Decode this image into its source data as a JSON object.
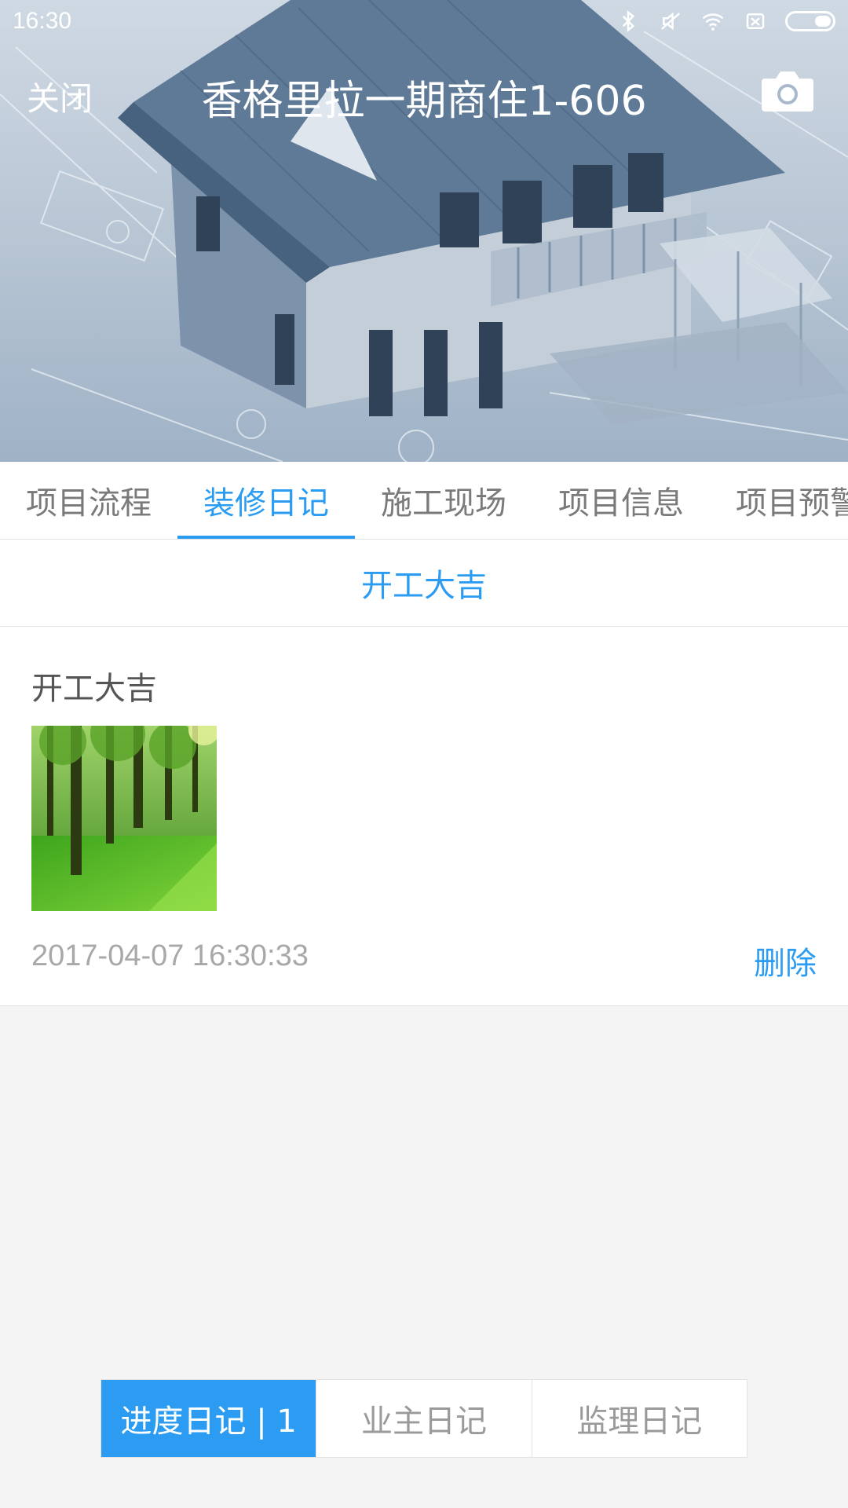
{
  "status_bar": {
    "time": "16:30"
  },
  "header": {
    "close_label": "关闭",
    "title": "香格里拉一期商住1-606"
  },
  "tabs": [
    {
      "label": "项目流程",
      "active": false
    },
    {
      "label": "装修日记",
      "active": true
    },
    {
      "label": "施工现场",
      "active": false
    },
    {
      "label": "项目信息",
      "active": false
    },
    {
      "label": "项目预警",
      "active": false
    }
  ],
  "sub_header": {
    "label": "开工大吉"
  },
  "entry": {
    "title": "开工大吉",
    "timestamp": "2017-04-07 16:30:33",
    "delete_label": "删除"
  },
  "segments": [
    {
      "label": "进度日记 | 1",
      "active": true
    },
    {
      "label": "业主日记",
      "active": false
    },
    {
      "label": "监理日记",
      "active": false
    }
  ],
  "colors": {
    "accent": "#2b9cf2",
    "muted_text": "#a8a8a8",
    "background": "#f4f4f4"
  }
}
